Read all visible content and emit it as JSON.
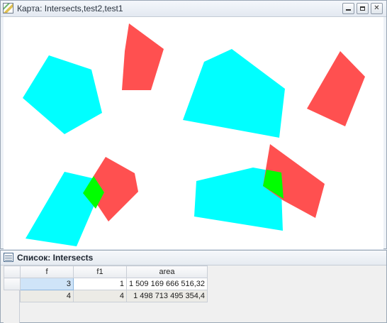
{
  "map_window": {
    "title": "Карта: Intersects,test2,test1",
    "icon": "map-window-icon",
    "buttons": {
      "minimize": "minimize-icon",
      "restore": "restore-icon",
      "close": "close-icon"
    },
    "colors": {
      "test2": "#00ffff",
      "test1": "#ff4f4f",
      "intersects": "#00ff00"
    }
  },
  "list_window": {
    "title": "Список: Intersects",
    "icon": "list-window-icon",
    "columns": [
      "f",
      "f1",
      "area"
    ],
    "rows": [
      {
        "f": "3",
        "f1": "1",
        "area": "1 509 169 666 516,32"
      },
      {
        "f": "4",
        "f1": "4",
        "area": "1 498 713 495 354,4"
      }
    ]
  }
}
